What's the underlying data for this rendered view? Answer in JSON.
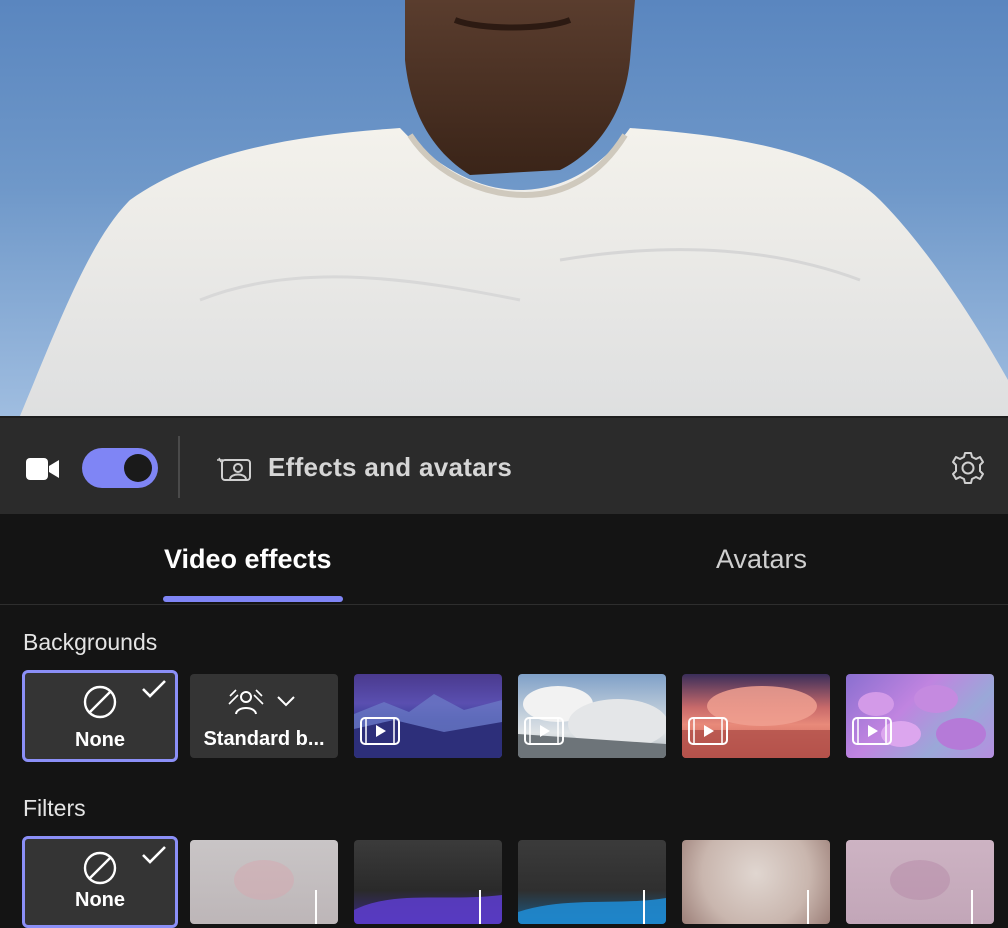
{
  "toolbar": {
    "title": "Effects and avatars",
    "camera_on": true
  },
  "tabs": [
    {
      "label": "Video effects",
      "active": true
    },
    {
      "label": "Avatars",
      "active": false
    }
  ],
  "sections": {
    "backgrounds": {
      "title": "Backgrounds",
      "tiles": [
        {
          "label": "None",
          "selected": true
        },
        {
          "label": "Standard b..."
        },
        {
          "label": "",
          "video": true
        },
        {
          "label": "",
          "video": true
        },
        {
          "label": "",
          "video": true
        },
        {
          "label": "",
          "video": true
        }
      ]
    },
    "filters": {
      "title": "Filters",
      "tiles": [
        {
          "label": "None",
          "selected": true
        }
      ]
    }
  },
  "colors": {
    "accent": "#7f85f5",
    "toolbar_bg": "#2b2b2b",
    "panel_bg": "#141414"
  }
}
